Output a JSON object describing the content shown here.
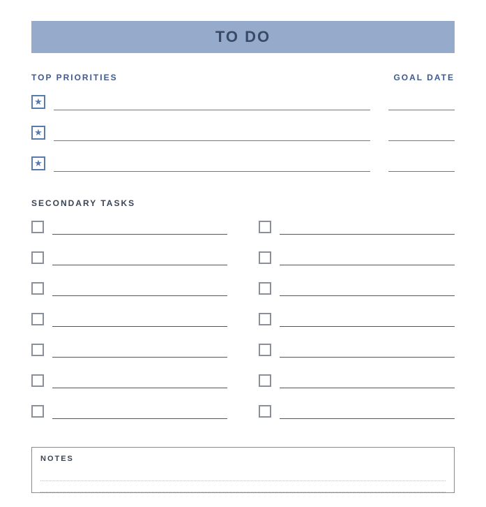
{
  "header": {
    "title": "TO DO"
  },
  "priorities": {
    "label": "TOP PRIORITIES",
    "goal_label": "GOAL DATE",
    "star": "★",
    "rows": [
      {
        "text": "",
        "goal": ""
      },
      {
        "text": "",
        "goal": ""
      },
      {
        "text": "",
        "goal": ""
      }
    ]
  },
  "secondary": {
    "label": "SECONDARY TASKS",
    "left": [
      {
        "text": ""
      },
      {
        "text": ""
      },
      {
        "text": ""
      },
      {
        "text": ""
      },
      {
        "text": ""
      },
      {
        "text": ""
      },
      {
        "text": ""
      }
    ],
    "right": [
      {
        "text": ""
      },
      {
        "text": ""
      },
      {
        "text": ""
      },
      {
        "text": ""
      },
      {
        "text": ""
      },
      {
        "text": ""
      },
      {
        "text": ""
      }
    ]
  },
  "notes": {
    "label": "NOTES",
    "lines": [
      "",
      ""
    ]
  }
}
